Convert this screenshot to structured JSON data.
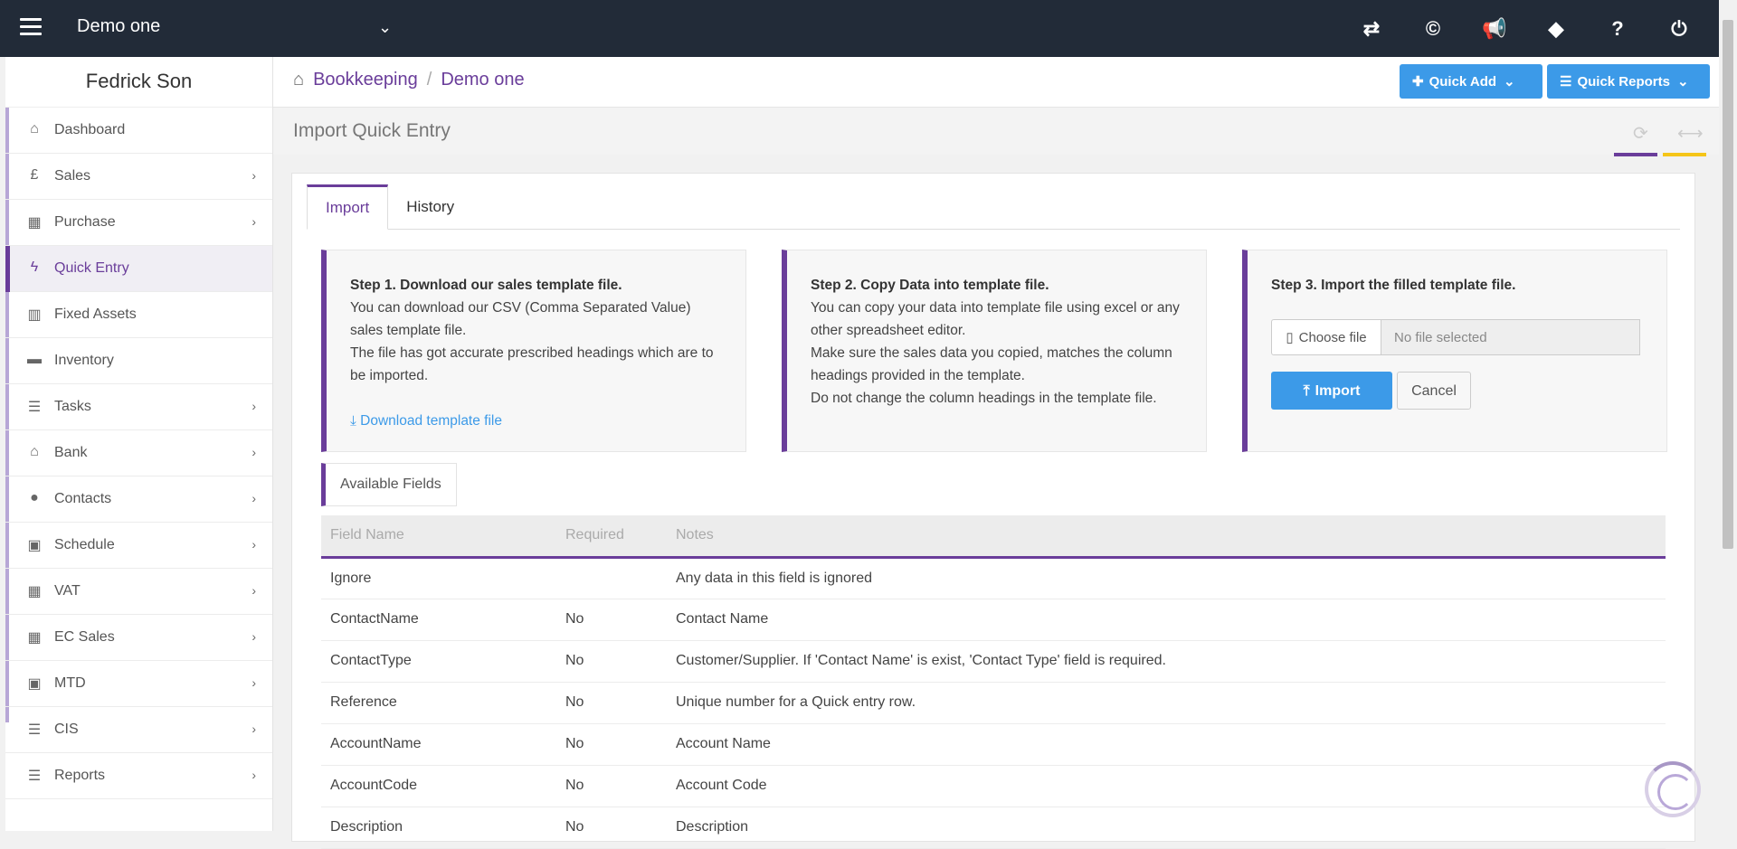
{
  "topbar": {
    "company": "Demo one",
    "icons": [
      "swap-icon",
      "copyright-icon",
      "megaphone-icon",
      "ticket-icon",
      "help-icon",
      "power-icon"
    ]
  },
  "sidebar": {
    "user": "Fedrick Son",
    "items": [
      {
        "label": "Dashboard",
        "icon": "home-icon",
        "glyph": "⌂",
        "has_chevron": false
      },
      {
        "label": "Sales",
        "icon": "pound-icon",
        "glyph": "£",
        "has_chevron": true
      },
      {
        "label": "Purchase",
        "icon": "grid-icon",
        "glyph": "▦",
        "has_chevron": true
      },
      {
        "label": "Quick Entry",
        "icon": "bolt-icon",
        "glyph": "ϟ",
        "has_chevron": false
      },
      {
        "label": "Fixed Assets",
        "icon": "building-icon",
        "glyph": "▥",
        "has_chevron": false
      },
      {
        "label": "Inventory",
        "icon": "truck-icon",
        "glyph": "▬",
        "has_chevron": false
      },
      {
        "label": "Tasks",
        "icon": "tasks-icon",
        "glyph": "☰",
        "has_chevron": true
      },
      {
        "label": "Bank",
        "icon": "bank-icon",
        "glyph": "⌂",
        "has_chevron": true
      },
      {
        "label": "Contacts",
        "icon": "users-icon",
        "glyph": "●",
        "has_chevron": true
      },
      {
        "label": "Schedule",
        "icon": "calendar-icon",
        "glyph": "▣",
        "has_chevron": true
      },
      {
        "label": "VAT",
        "icon": "calculator-icon",
        "glyph": "▦",
        "has_chevron": true
      },
      {
        "label": "EC Sales",
        "icon": "calculator-icon",
        "glyph": "▦",
        "has_chevron": true
      },
      {
        "label": "MTD",
        "icon": "calendar-icon",
        "glyph": "▣",
        "has_chevron": true
      },
      {
        "label": "CIS",
        "icon": "indent-icon",
        "glyph": "☰",
        "has_chevron": true
      },
      {
        "label": "Reports",
        "icon": "list-icon",
        "glyph": "☰",
        "has_chevron": true
      }
    ]
  },
  "breadcrumb": {
    "root": "Bookkeeping",
    "current": "Demo one"
  },
  "header_buttons": {
    "quick_add": "Quick Add",
    "quick_reports": "Quick Reports"
  },
  "page_title": "Import Quick Entry",
  "tabs": [
    "Import",
    "History"
  ],
  "steps": {
    "step1": {
      "title": "Step 1. Download our sales template file.",
      "text": "You can download our CSV (Comma Separated Value) sales template file.",
      "text2": "The file has got accurate prescribed headings which are to be imported.",
      "link": "Download template file"
    },
    "step2": {
      "title": "Step 2. Copy Data into template file.",
      "text": "You can copy your data into template file using excel or any other spreadsheet editor.",
      "text2": "Make sure the sales data you copied, matches the column headings provided in the template.",
      "text3": "Do not change the column headings in the template file."
    },
    "step3": {
      "title": "Step 3. Import the filled template file.",
      "choose_file": "Choose file",
      "no_file": "No file selected",
      "import": "Import",
      "cancel": "Cancel"
    }
  },
  "available_fields_label": "Available Fields",
  "fields_table": {
    "headers": [
      "Field Name",
      "Required",
      "Notes"
    ],
    "rows": [
      [
        "Ignore",
        "",
        "Any data in this field is ignored"
      ],
      [
        "ContactName",
        "No",
        "Contact Name"
      ],
      [
        "ContactType",
        "No",
        "Customer/Supplier. If 'Contact Name' is exist, 'Contact Type' field is required."
      ],
      [
        "Reference",
        "No",
        "Unique number for a Quick entry row."
      ],
      [
        "AccountName",
        "No",
        "Account Name"
      ],
      [
        "AccountCode",
        "No",
        "Account Code"
      ],
      [
        "Description",
        "No",
        "Description"
      ]
    ]
  },
  "colors": {
    "accent": "#6a3d9a",
    "primary": "#3c9ae8",
    "topbar": "#222b38",
    "warning": "#f5c518"
  }
}
